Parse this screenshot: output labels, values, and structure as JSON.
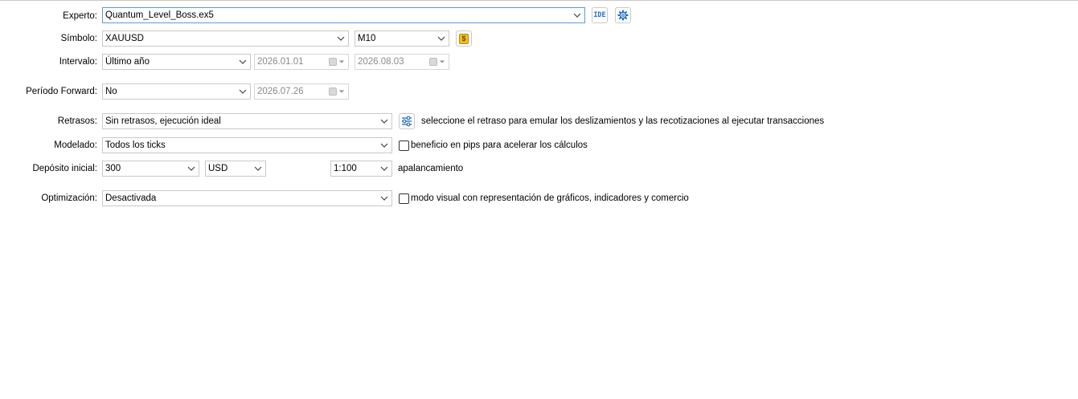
{
  "labels": {
    "expert": "Experto:",
    "symbol": "Símbolo:",
    "interval": "Intervalo:",
    "forward": "Período Forward:",
    "delays": "Retrasos:",
    "modeling": "Modelado:",
    "deposit": "Depósito inicial:",
    "optimization": "Optimización:"
  },
  "expert": {
    "value": "Quantum_Level_Boss.ex5",
    "ide_label": "IDE"
  },
  "symbol": {
    "value": "XAUUSD",
    "timeframe": "M10",
    "currency_icon_glyph": "$"
  },
  "interval": {
    "value": "Último año",
    "date_from": "2026.01.01",
    "date_to": "2026.08.03"
  },
  "forward": {
    "value": "No",
    "date": "2026.07.26"
  },
  "delays": {
    "value": "Sin retrasos, ejecución ideal",
    "hint": "seleccione el retraso para emular los deslizamientos y las recotizaciones al ejecutar transacciones"
  },
  "modeling": {
    "value": "Todos los ticks",
    "checkbox_label": "beneficio en pips para acelerar los cálculos",
    "checked": false
  },
  "deposit": {
    "amount": "300",
    "currency": "USD",
    "leverage": "1:100",
    "leverage_label": "apalancamiento"
  },
  "optimization": {
    "value": "Desactivada",
    "checkbox_label": "modo visual con representación de gráficos, indicadores y comercio",
    "checked": false
  },
  "colors": {
    "accent_border": "#5b9bd5",
    "icon_blue": "#1f6fc5",
    "money_icon_bg": "#f2c01e"
  },
  "icons": [
    "chevron-down-icon",
    "gear-icon",
    "money-icon",
    "sliders-icon",
    "calendar-icon"
  ]
}
